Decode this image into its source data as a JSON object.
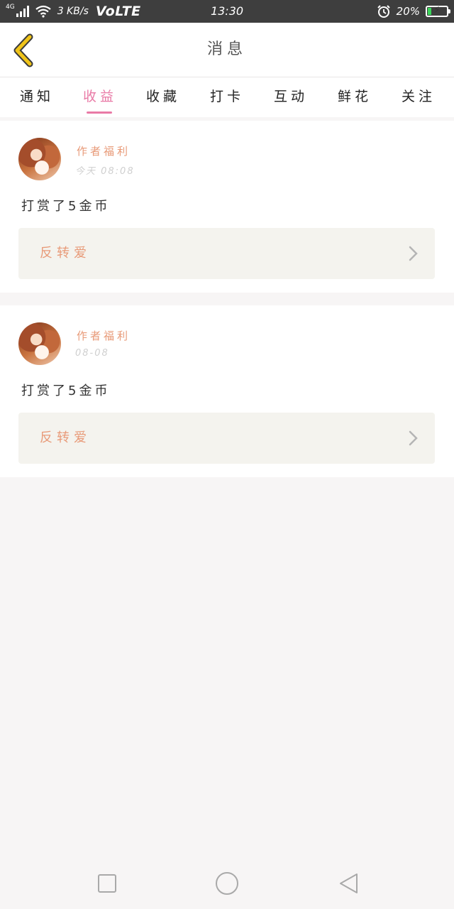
{
  "status_bar": {
    "network": "4G",
    "speed": "3 KB/s",
    "volte": "VoLTE",
    "time": "13:30",
    "battery": "20%",
    "battery_level": 0.2,
    "battery_color": "#3ad65a",
    "icons": [
      "signal-icon",
      "wifi-icon",
      "alarm-icon",
      "battery-icon"
    ]
  },
  "header": {
    "title": "消息",
    "back_icon": "chevron-left-icon",
    "back_color": "#f0c419"
  },
  "tabs": [
    {
      "label": "通知"
    },
    {
      "label": "收益"
    },
    {
      "label": "收藏"
    },
    {
      "label": "打卡"
    },
    {
      "label": "互动"
    },
    {
      "label": "鲜花"
    },
    {
      "label": "关注"
    }
  ],
  "active_tab": "收益",
  "accent_color": "#e97aa6",
  "messages": [
    {
      "author": "作者福利",
      "time": "今天 08:08",
      "text": "打赏了5金币",
      "book": "反转爱"
    },
    {
      "author": "作者福利",
      "time": "08-08",
      "text": "打赏了5金币",
      "book": "反转爱"
    }
  ],
  "system_nav": {
    "icons": [
      "square-icon",
      "circle-icon",
      "triangle-back-icon"
    ]
  }
}
